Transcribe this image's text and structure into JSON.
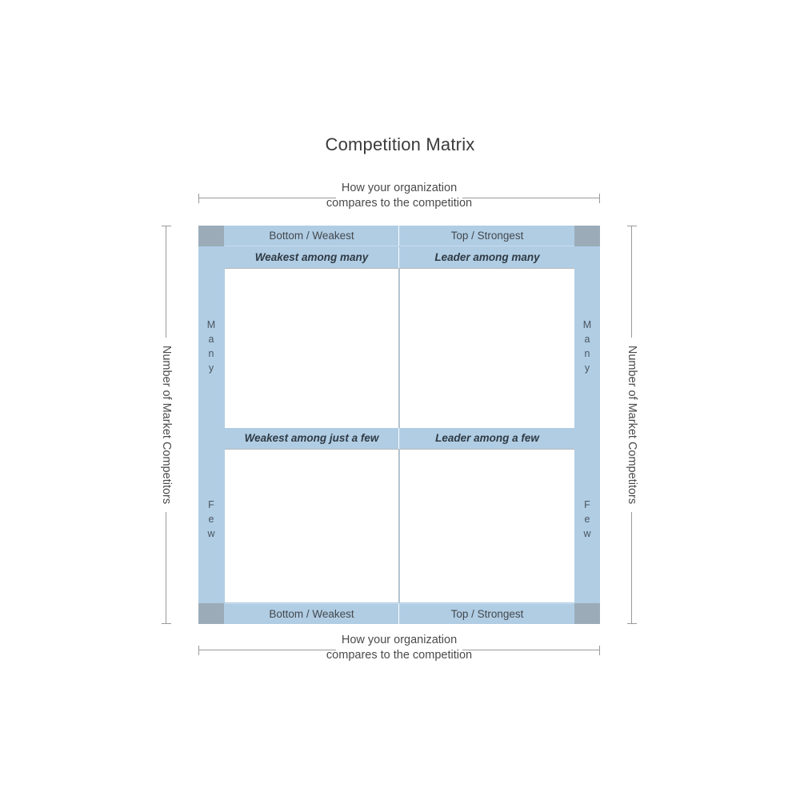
{
  "title": "Competition Matrix",
  "axes": {
    "horizontal_label": "How your organization compares to the competition",
    "horizontal_label_line1": "How your organization",
    "horizontal_label_line2": "compares to the competition",
    "vertical_label": "Number of Market Competitors"
  },
  "columns": {
    "left_header": "Bottom / Weakest",
    "right_header": "Top / Strongest"
  },
  "rows": {
    "top_label_letters": [
      "M",
      "a",
      "n",
      "y"
    ],
    "top_label": "Many",
    "bottom_label_letters": [
      "F",
      "e",
      "w"
    ],
    "bottom_label": "Few"
  },
  "quadrants": {
    "top_left": "Weakest among many",
    "top_right": "Leader among many",
    "bottom_left": "Weakest among just a few",
    "bottom_right": "Leader among a few"
  },
  "colors": {
    "rail_blue": "#b0cde4",
    "corner_gray": "#9bacb8",
    "panel_white": "#ffffff",
    "header_text": "#44484c",
    "quadrant_text": "#2f3a44",
    "axis_line": "#9a9a9a",
    "title_text": "#3b3b3b"
  }
}
